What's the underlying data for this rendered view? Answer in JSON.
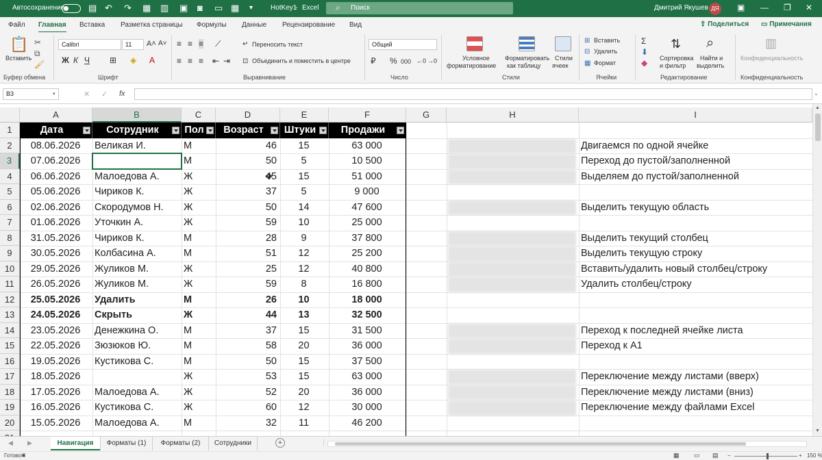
{
  "titlebar": {
    "autosave": "Автосохранение",
    "filename": "HotKey1",
    "app": "Excel",
    "search_placeholder": "Поиск",
    "user": "Дмитрий Якушев",
    "initials": "ДЯ",
    "accent": "#1f7145"
  },
  "tabs": [
    "Файл",
    "Главная",
    "Вставка",
    "Разметка страницы",
    "Формулы",
    "Данные",
    "Рецензирование",
    "Вид"
  ],
  "share": "Поделиться",
  "notes": "Примечания",
  "ribbon": {
    "clipboard": {
      "paste": "Вставить",
      "group": "Буфер обмена"
    },
    "font": {
      "name": "Calibri",
      "size": "11",
      "group": "Шрифт",
      "bold": "Ж",
      "italic": "К",
      "underline": "Ч"
    },
    "alignment": {
      "wrap": "Переносить текст",
      "merge": "Объединить и поместить в центре",
      "group": "Выравнивание"
    },
    "number": {
      "format": "Общий",
      "group": "Число",
      "percent": "%",
      "thousands": "000"
    },
    "styles": {
      "cond1": "Условное",
      "cond2": "форматирование",
      "tbl1": "Форматировать",
      "tbl2": "как таблицу",
      "cell1": "Стили",
      "cell2": "ячеек",
      "group": "Стили"
    },
    "cells": {
      "insert": "Вставить",
      "delete": "Удалить",
      "format": "Формат",
      "group": "Ячейки"
    },
    "editing": {
      "sort1": "Сортировка",
      "sort2": "и фильтр",
      "find1": "Найти и",
      "find2": "выделить",
      "sum": "Σ",
      "group": "Редактирование"
    },
    "sensitivity": {
      "label": "Конфиденциальность",
      "group": "Конфиденциальность"
    }
  },
  "formula_bar": {
    "name_box": "B3",
    "fx": "fx",
    "value": ""
  },
  "columns": [
    "A",
    "B",
    "C",
    "D",
    "E",
    "F",
    "G",
    "H",
    "I"
  ],
  "table_headers": [
    "Дата",
    "Сотрудник",
    "Пол",
    "Возраст",
    "Штуки",
    "Продажи"
  ],
  "rows": [
    {
      "n": "2",
      "date": "08.06.2026",
      "emp": "Великая И.",
      "sex": "М",
      "age": "46",
      "qty": "15",
      "sales": "63 000"
    },
    {
      "n": "3",
      "date": "07.06.2026",
      "emp": "",
      "sex": "М",
      "age": "50",
      "qty": "5",
      "sales": "10 500"
    },
    {
      "n": "4",
      "date": "06.06.2026",
      "emp": "Малоедова А.",
      "sex": "Ж",
      "age": "45",
      "qty": "15",
      "sales": "51 000"
    },
    {
      "n": "5",
      "date": "05.06.2026",
      "emp": "Чириков К.",
      "sex": "Ж",
      "age": "37",
      "qty": "5",
      "sales": "9 000"
    },
    {
      "n": "6",
      "date": "02.06.2026",
      "emp": "Скородумов Н.",
      "sex": "Ж",
      "age": "50",
      "qty": "14",
      "sales": "47 600"
    },
    {
      "n": "7",
      "date": "01.06.2026",
      "emp": "Уточкин А.",
      "sex": "Ж",
      "age": "59",
      "qty": "10",
      "sales": "25 000"
    },
    {
      "n": "8",
      "date": "31.05.2026",
      "emp": "Чириков К.",
      "sex": "М",
      "age": "28",
      "qty": "9",
      "sales": "37 800"
    },
    {
      "n": "9",
      "date": "30.05.2026",
      "emp": "Колбасина А.",
      "sex": "М",
      "age": "51",
      "qty": "12",
      "sales": "25 200"
    },
    {
      "n": "10",
      "date": "29.05.2026",
      "emp": "Жуликов М.",
      "sex": "Ж",
      "age": "25",
      "qty": "12",
      "sales": "40 800"
    },
    {
      "n": "11",
      "date": "26.05.2026",
      "emp": "Жуликов М.",
      "sex": "Ж",
      "age": "59",
      "qty": "8",
      "sales": "16 800"
    },
    {
      "n": "12",
      "date": "25.05.2026",
      "emp": "Удалить",
      "sex": "М",
      "age": "26",
      "qty": "10",
      "sales": "18 000",
      "bold": true
    },
    {
      "n": "13",
      "date": "24.05.2026",
      "emp": "Скрыть",
      "sex": "Ж",
      "age": "44",
      "qty": "13",
      "sales": "32 500",
      "bold": true
    },
    {
      "n": "14",
      "date": "23.05.2026",
      "emp": "Денежкина О.",
      "sex": "М",
      "age": "37",
      "qty": "15",
      "sales": "31 500"
    },
    {
      "n": "15",
      "date": "22.05.2026",
      "emp": "Зюзюков Ю.",
      "sex": "М",
      "age": "58",
      "qty": "20",
      "sales": "36 000"
    },
    {
      "n": "16",
      "date": "19.05.2026",
      "emp": "Кустикова С.",
      "sex": "М",
      "age": "50",
      "qty": "15",
      "sales": "37 500"
    },
    {
      "n": "17",
      "date": "18.05.2026",
      "emp": "",
      "sex": "Ж",
      "age": "53",
      "qty": "15",
      "sales": "63 000"
    },
    {
      "n": "18",
      "date": "17.05.2026",
      "emp": "Малоедова А.",
      "sex": "Ж",
      "age": "52",
      "qty": "20",
      "sales": "36 000"
    },
    {
      "n": "19",
      "date": "16.05.2026",
      "emp": "Кустикова С.",
      "sex": "Ж",
      "age": "60",
      "qty": "12",
      "sales": "30 000"
    },
    {
      "n": "20",
      "date": "15.05.2026",
      "emp": "Малоедова А.",
      "sex": "М",
      "age": "32",
      "qty": "11",
      "sales": "46 200"
    }
  ],
  "hotkeys": [
    {
      "row": 2,
      "text": "Двигаемся по одной ячейке"
    },
    {
      "row": 3,
      "text": "Переход до пустой/заполненной"
    },
    {
      "row": 4,
      "text": "Выделяем до пустой/заполненной"
    },
    {
      "row": 6,
      "text": "Выделить текущую область"
    },
    {
      "row": 8,
      "text": "Выделить текущий столбец"
    },
    {
      "row": 9,
      "text": "Выделить текущую строку"
    },
    {
      "row": 10,
      "text": "Вставить/удалить новый столбец/строку"
    },
    {
      "row": 11,
      "text": "Удалить столбец/строку"
    },
    {
      "row": 14,
      "text": "Переход к последней ячейке листа"
    },
    {
      "row": 15,
      "text": "Переход к А1"
    },
    {
      "row": 17,
      "text": "Переключение между листами (вверх)"
    },
    {
      "row": 18,
      "text": "Переключение между листами (вниз)"
    },
    {
      "row": 19,
      "text": "Переключение между файлами Excel"
    }
  ],
  "sheet_tabs": [
    "Навигация",
    "Форматы (1)",
    "Форматы (2)",
    "Сотрудники"
  ],
  "status": {
    "ready": "Готово",
    "zoom": "150 %"
  }
}
